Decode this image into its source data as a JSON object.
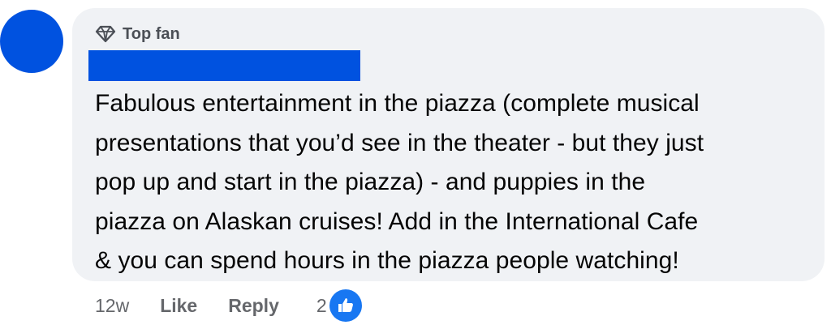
{
  "comment": {
    "badge": "Top fan",
    "text_lines": [
      "Fabulous entertainment in the piazza (complete musical",
      "presentations that you’d see in the theater - but they just",
      "pop up and start in the piazza) - and puppies in the",
      "piazza on Alaskan cruises! Add in the International Cafe",
      "& you can spend hours in the piazza people watching!"
    ]
  },
  "actions": {
    "time": "12w",
    "like": "Like",
    "reply": "Reply",
    "reaction_count": "2"
  },
  "icons": {
    "badge_icon": "diamond-icon",
    "reaction_icon": "thumbs-up-icon"
  },
  "colors": {
    "accent": "#0052e0",
    "bubble": "#f0f2f5",
    "secondary_text": "#65676b",
    "like_blue": "#1877f2"
  }
}
